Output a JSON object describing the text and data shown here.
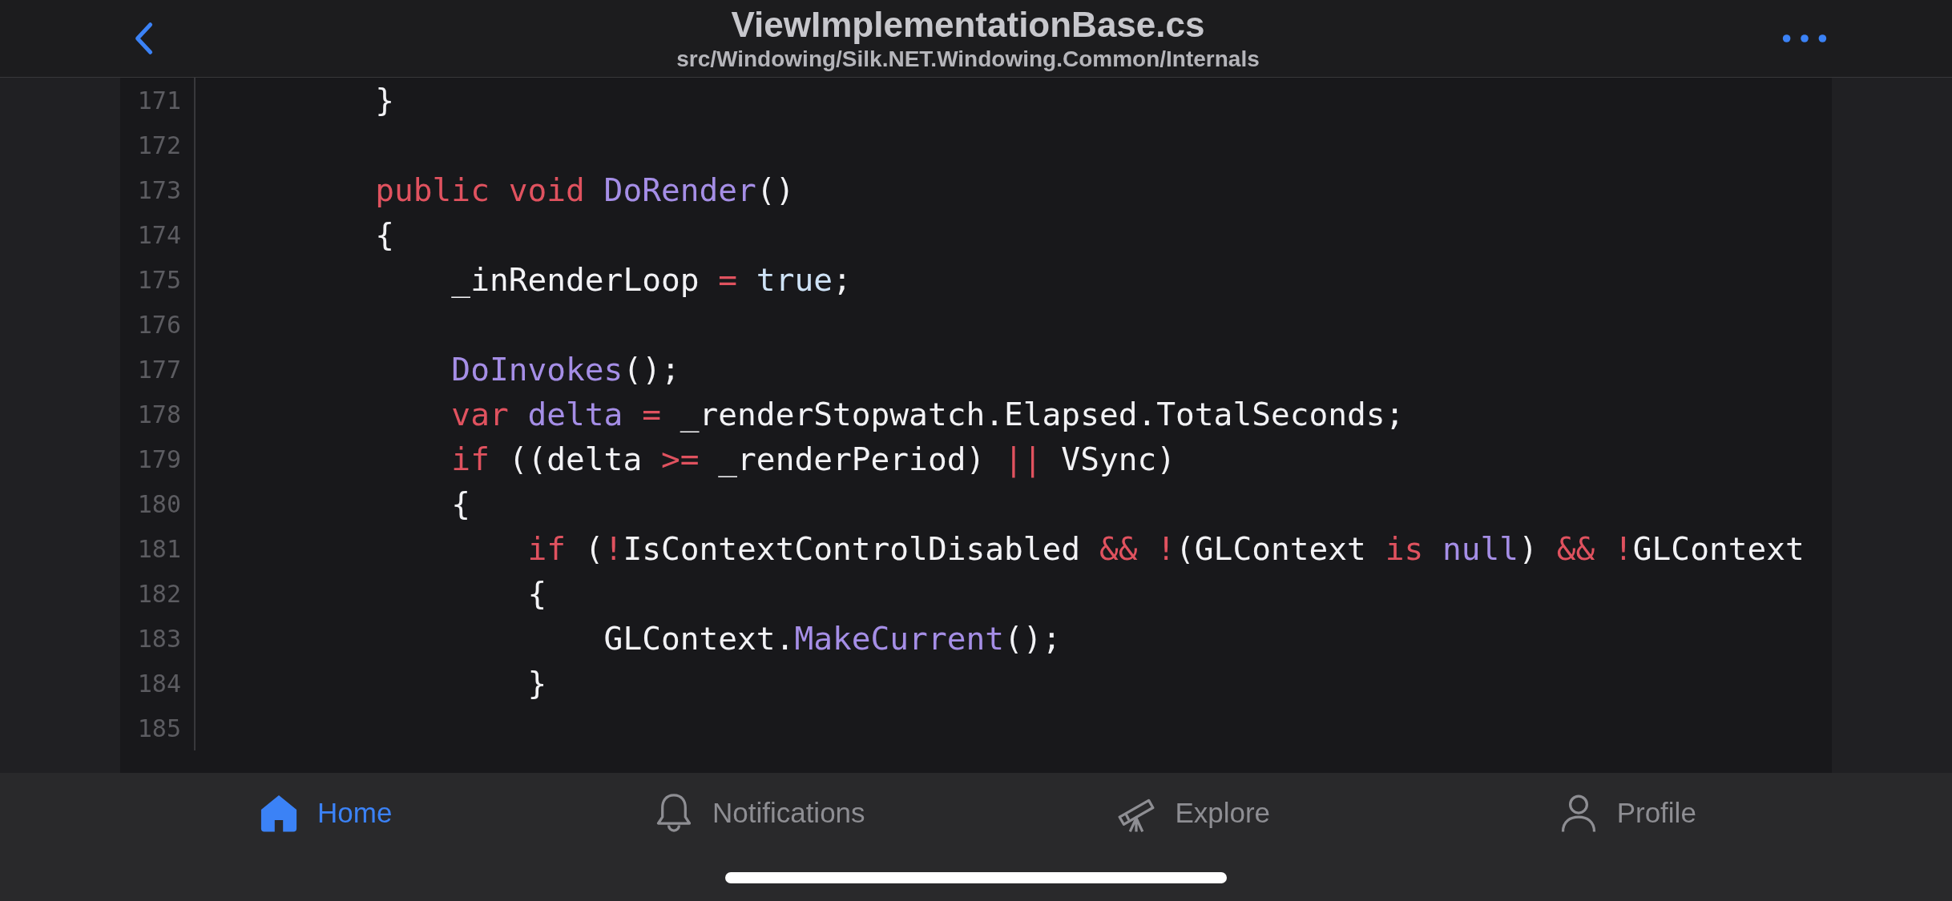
{
  "header": {
    "title": "ViewImplementationBase.cs",
    "subtitle": "src/Windowing/Silk.NET.Windowing.Common/Internals"
  },
  "code": {
    "lines": [
      {
        "number": "171",
        "tokens": [
          {
            "kind": "plain",
            "text": "        }"
          }
        ]
      },
      {
        "number": "172"
      },
      {
        "number": "173",
        "tokens": [
          {
            "kind": "keyword",
            "text": "        public"
          },
          {
            "kind": "keyword",
            "text": " void"
          },
          {
            "kind": "function",
            "text": " DoRender"
          },
          {
            "kind": "plain",
            "text": "()"
          }
        ]
      },
      {
        "number": "174",
        "tokens": [
          {
            "kind": "plain",
            "text": "        {"
          }
        ]
      },
      {
        "number": "175",
        "tokens": [
          {
            "kind": "plain",
            "text": "            _inRenderLoop "
          },
          {
            "kind": "keyword",
            "text": "="
          },
          {
            "kind": "literal",
            "text": " true"
          },
          {
            "kind": "plain",
            "text": ";"
          }
        ]
      },
      {
        "number": "176"
      },
      {
        "number": "177",
        "tokens": [
          {
            "kind": "function",
            "text": "            DoInvokes"
          },
          {
            "kind": "plain",
            "text": "();"
          }
        ]
      },
      {
        "number": "178",
        "tokens": [
          {
            "kind": "keyword",
            "text": "            var"
          },
          {
            "kind": "function",
            "text": " delta"
          },
          {
            "kind": "keyword",
            "text": " ="
          },
          {
            "kind": "plain",
            "text": " _renderStopwatch.Elapsed.TotalSeconds;"
          }
        ]
      },
      {
        "number": "179",
        "tokens": [
          {
            "kind": "keyword",
            "text": "            if"
          },
          {
            "kind": "plain",
            "text": " ((delta "
          },
          {
            "kind": "keyword",
            "text": ">="
          },
          {
            "kind": "plain",
            "text": " _renderPeriod) "
          },
          {
            "kind": "keyword",
            "text": "||"
          },
          {
            "kind": "plain",
            "text": " VSync)"
          }
        ]
      },
      {
        "number": "180",
        "tokens": [
          {
            "kind": "plain",
            "text": "            {"
          }
        ]
      },
      {
        "number": "181",
        "tokens": [
          {
            "kind": "keyword",
            "text": "                if"
          },
          {
            "kind": "plain",
            "text": " ("
          },
          {
            "kind": "keyword",
            "text": "!"
          },
          {
            "kind": "plain",
            "text": "IsContextControlDisabled "
          },
          {
            "kind": "keyword",
            "text": "&&"
          },
          {
            "kind": "keyword",
            "text": " !"
          },
          {
            "kind": "plain",
            "text": "(GLContext "
          },
          {
            "kind": "keyword",
            "text": "is"
          },
          {
            "kind": "function",
            "text": " null"
          },
          {
            "kind": "plain",
            "text": ") "
          },
          {
            "kind": "keyword",
            "text": "&&"
          },
          {
            "kind": "keyword",
            "text": " !"
          },
          {
            "kind": "plain",
            "text": "GLContext"
          }
        ]
      },
      {
        "number": "182",
        "tokens": [
          {
            "kind": "plain",
            "text": "                {"
          }
        ]
      },
      {
        "number": "183",
        "tokens": [
          {
            "kind": "plain",
            "text": "                    GLContext."
          },
          {
            "kind": "function",
            "text": "MakeCurrent"
          },
          {
            "kind": "plain",
            "text": "();"
          }
        ]
      },
      {
        "number": "184",
        "tokens": [
          {
            "kind": "plain",
            "text": "                }"
          }
        ]
      },
      {
        "number": "185"
      }
    ]
  },
  "tabs": [
    {
      "label": "Home",
      "selected": true
    },
    {
      "label": "Notifications",
      "selected": false
    },
    {
      "label": "Explore",
      "selected": false
    },
    {
      "label": "Profile",
      "selected": false
    }
  ]
}
